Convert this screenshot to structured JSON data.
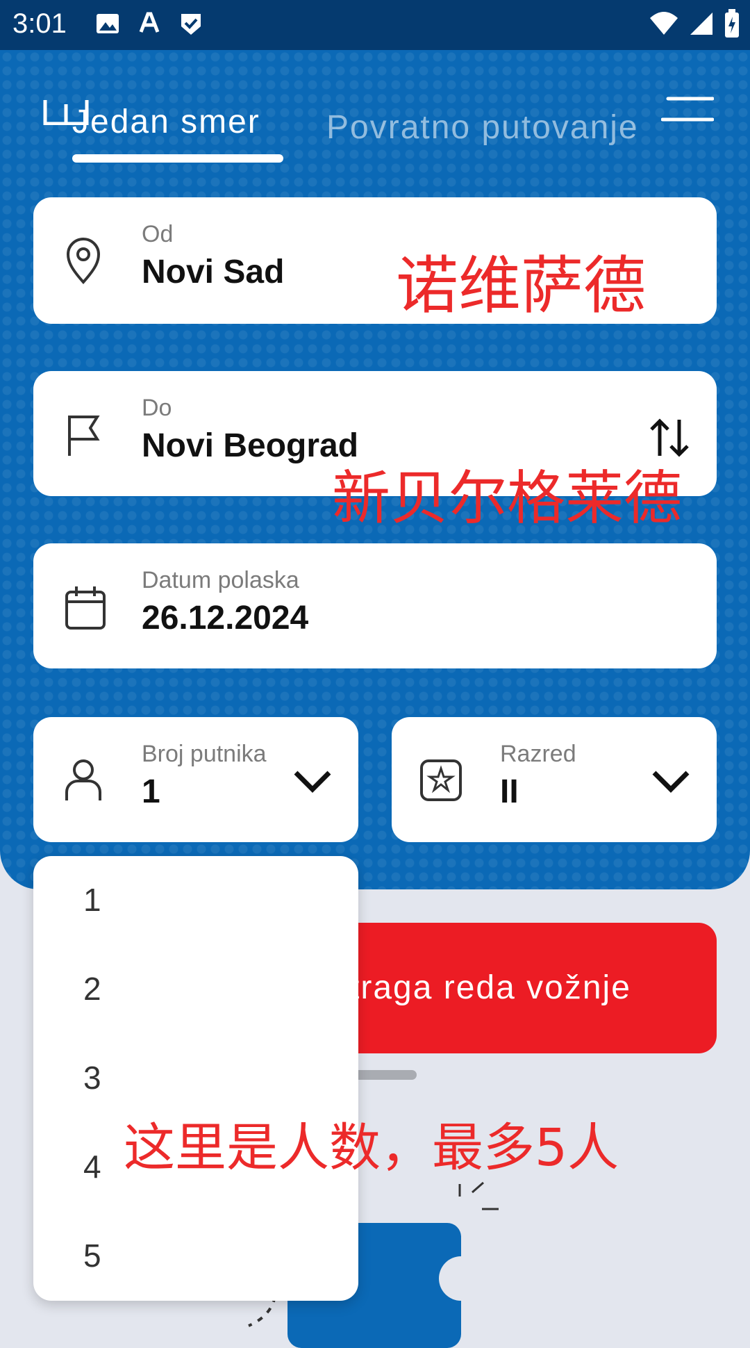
{
  "status_bar": {
    "time": "3:01",
    "icons_left": [
      "image-icon",
      "font-icon",
      "check-shield-icon"
    ],
    "icons_right": [
      "wifi-icon",
      "signal-icon",
      "battery-icon"
    ]
  },
  "tabs": [
    {
      "label": "Jedan smer",
      "active": true
    },
    {
      "label": "Povratno putovanje",
      "active": false
    }
  ],
  "form": {
    "from": {
      "label": "Od",
      "value": "Novi Sad",
      "icon": "location-pin-icon"
    },
    "to": {
      "label": "Do",
      "value": "Novi Beograd",
      "icon": "flag-icon",
      "swap_icon": "swap-icon"
    },
    "date": {
      "label": "Datum polaska",
      "value": "26.12.2024",
      "icon": "calendar-icon"
    },
    "passengers": {
      "label": "Broj putnika",
      "value": "1",
      "icon": "person-icon"
    },
    "class": {
      "label": "Razred",
      "value": "II",
      "icon": "star-badge-icon"
    }
  },
  "search_button": {
    "label": "traga reda vožnje"
  },
  "dropdown": {
    "options": [
      "1",
      "2",
      "3",
      "4",
      "5"
    ]
  },
  "annotations": {
    "from_note": "诺维萨德",
    "to_note": "新贝尔格莱德",
    "passengers_note": "这里是人数，最多5人"
  },
  "colors": {
    "primary": "#0b69b6",
    "accent": "#ec1c24",
    "annotation": "#ec2a2a"
  }
}
